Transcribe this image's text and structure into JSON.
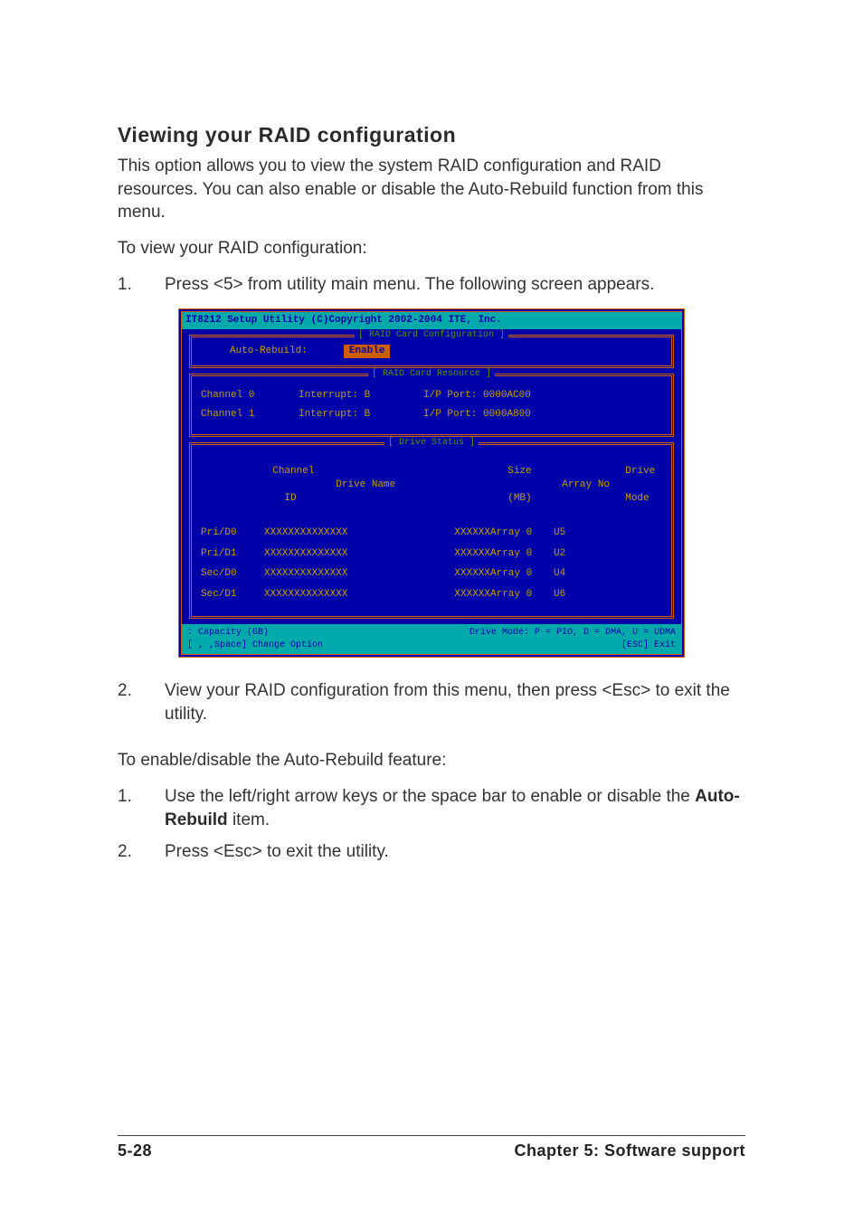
{
  "section_title": "Viewing your RAID configuration",
  "intro_paragraph": "This option allows you to view the system RAID configuration and RAID resources. You can also enable or disable the Auto-Rebuild function from this menu.",
  "para_to_view": "To view your RAID configuration:",
  "steps_view": [
    {
      "num": "1.",
      "text": "Press <5> from utility main menu. The following screen appears."
    }
  ],
  "terminal": {
    "titlebar": " IT8212 Setup Utility (C)Copyright 2002-2004 ITE, Inc.",
    "frame_cfg_label": "[ RAID Card Configuration ]",
    "cfg_label": "Auto-Rebuild:",
    "cfg_value": "Enable",
    "frame_res_label": "[ RAID Card Resource ]",
    "resources": [
      {
        "ch": "Channel 0",
        "int": "Interrupt: B",
        "port": "I/P Port: 0000AC00"
      },
      {
        "ch": "Channel 1",
        "int": "Interrupt: B",
        "port": "I/P Port: 0000A800"
      }
    ],
    "frame_ds_label": "[ Drive Status ]",
    "ds_header": {
      "col1a": "Channel",
      "col1b": "  ID",
      "col2": "Drive Name",
      "col3a": "Size",
      "col3b": "(MB)",
      "col4": "Array No",
      "col5a": "Drive",
      "col5b": "Mode"
    },
    "drives": [
      {
        "id": "Pri/D0",
        "name": "XXXXXXXXXXXXXX",
        "size": "XXXXXX",
        "array": "Array 0",
        "mode": "U5"
      },
      {
        "id": "Pri/D1",
        "name": "XXXXXXXXXXXXXX",
        "size": "XXXXXX",
        "array": "Array 0",
        "mode": "U2"
      },
      {
        "id": "Sec/D0",
        "name": "XXXXXXXXXXXXXX",
        "size": "XXXXXX",
        "array": "Array 0",
        "mode": "U4"
      },
      {
        "id": "Sec/D1",
        "name": "XXXXXXXXXXXXXX",
        "size": "XXXXXX",
        "array": "Array 0",
        "mode": "U6"
      }
    ],
    "footer": {
      "tl": " : Capacity (GB)",
      "tr": "Drive Mode: P = PIO, D = DMA, U = UDMA",
      "bl": "[ , ,Space] Change Option",
      "br": "[ESC] Exit"
    }
  },
  "steps_view2": [
    {
      "num": "2.",
      "text": "View your RAID configuration from this menu, then press <Esc> to exit the utility."
    }
  ],
  "para_to_enable": "To enable/disable the Auto-Rebuild feature:",
  "steps_enable": [
    {
      "num": "1.",
      "pre": "Use the left/right arrow keys or the space bar to enable or disable the ",
      "bold": "Auto-Rebuild",
      "post": " item."
    },
    {
      "num": "2.",
      "text": "Press <Esc> to exit the utility."
    }
  ],
  "footer": {
    "page_num": "5-28",
    "chapter": "Chapter 5: Software support"
  }
}
